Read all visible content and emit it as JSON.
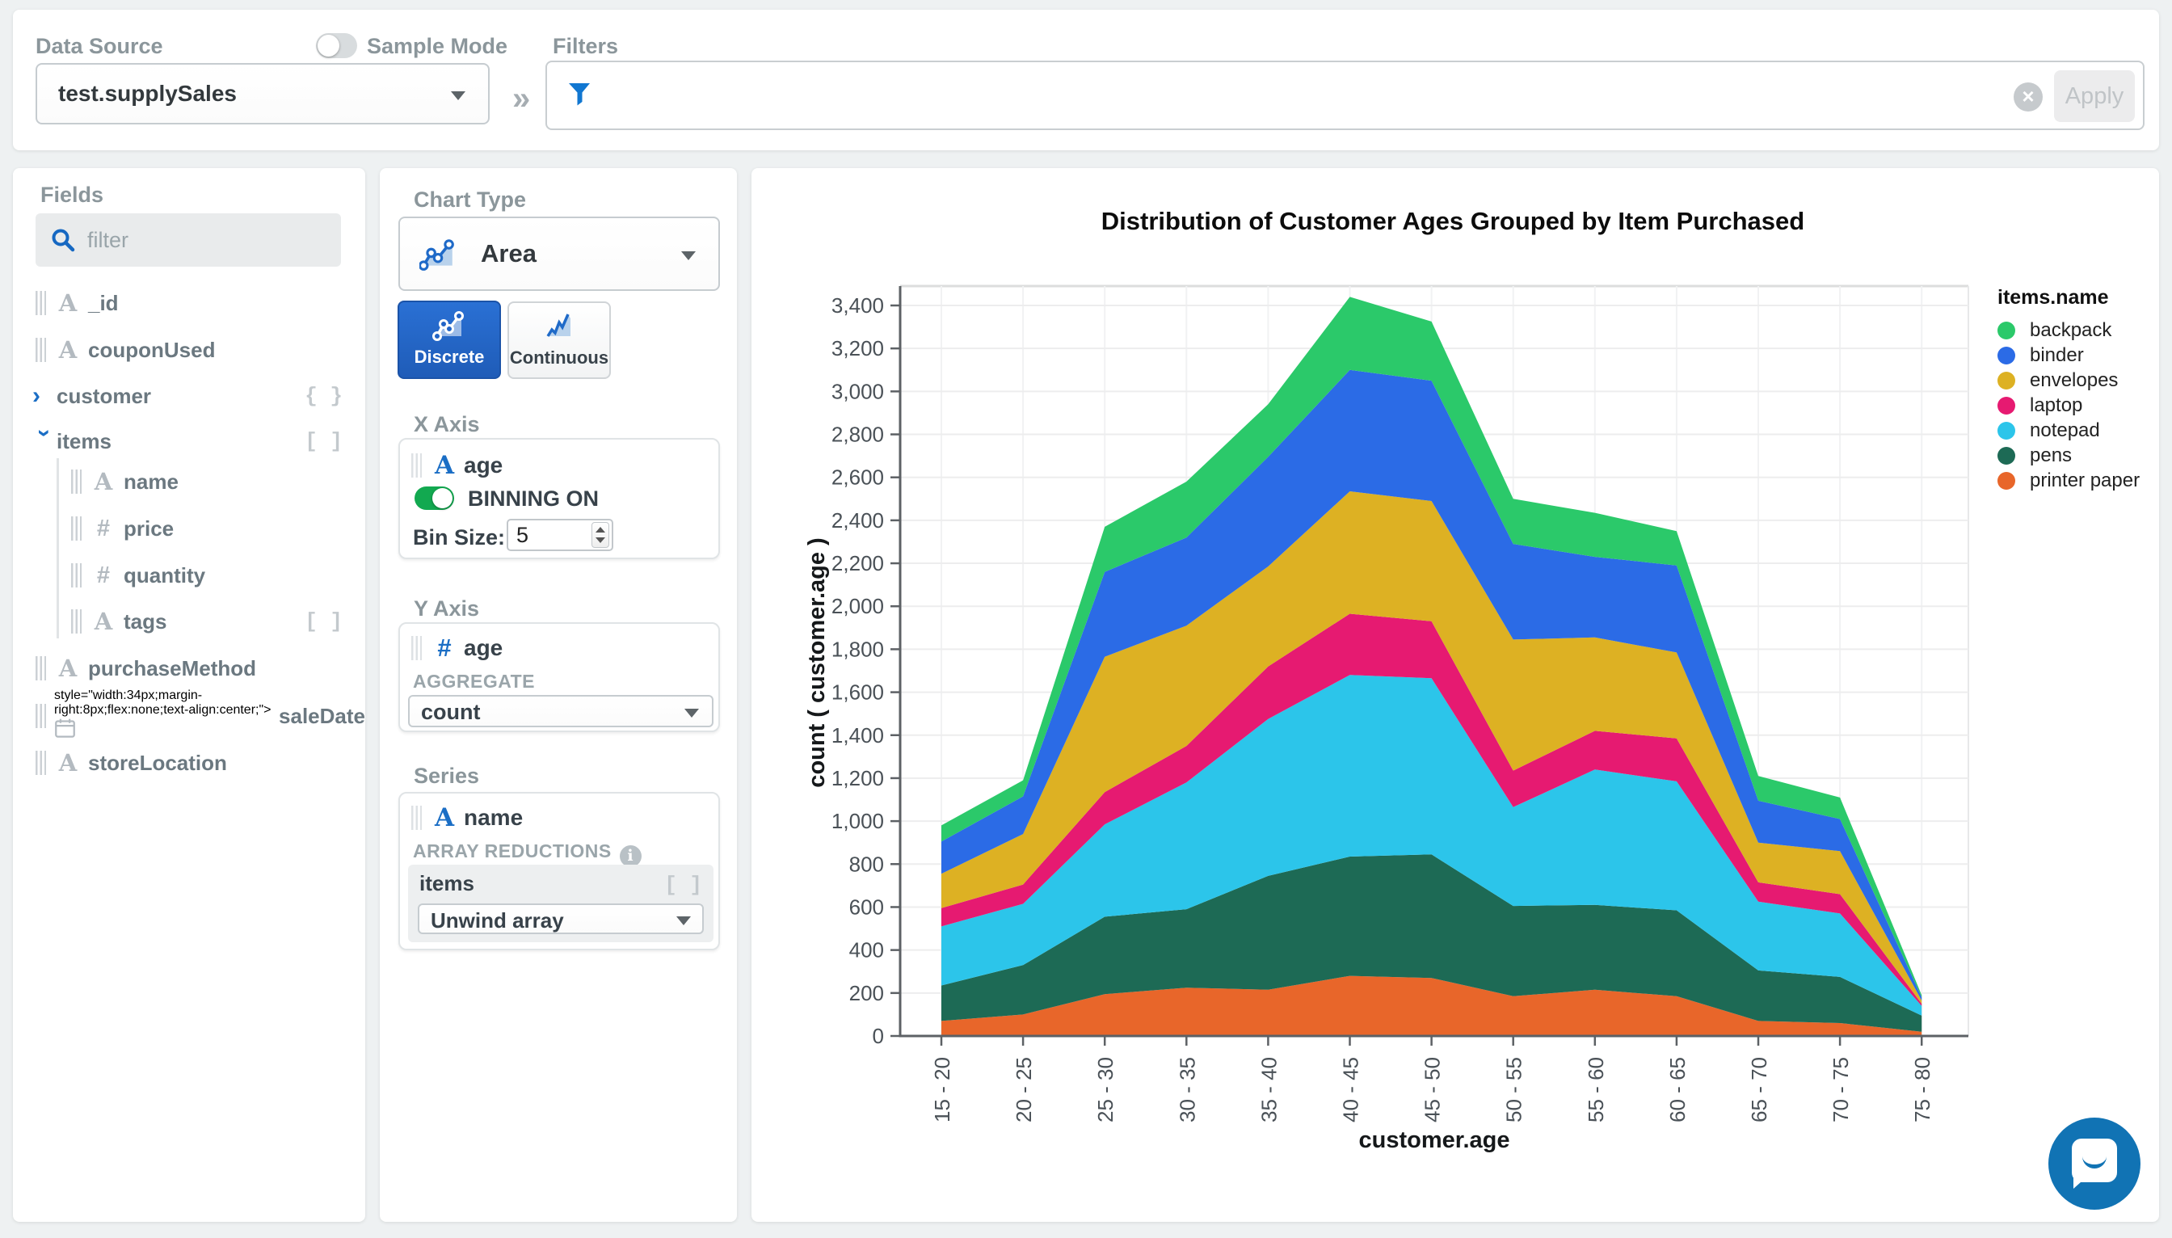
{
  "top_bar": {
    "data_source_label": "Data Source",
    "data_source_value": "test.supplySales",
    "sample_mode_label": "Sample Mode",
    "filters_label": "Filters",
    "chevron": "»",
    "clear_icon": "×",
    "apply_label": "Apply",
    "filter_value": ""
  },
  "fields_panel": {
    "title": "Fields",
    "filter_placeholder": "filter",
    "fields": [
      {
        "name": "_id",
        "type": "string"
      },
      {
        "name": "couponUsed",
        "type": "string"
      },
      {
        "name": "customer",
        "type": "object",
        "marker": "{ }",
        "expanded": false
      },
      {
        "name": "items",
        "type": "array",
        "marker": "[ ]",
        "expanded": true
      },
      {
        "name": "name",
        "type": "string",
        "nested": true
      },
      {
        "name": "price",
        "type": "number",
        "nested": true
      },
      {
        "name": "quantity",
        "type": "number",
        "nested": true
      },
      {
        "name": "tags",
        "type": "string",
        "nested": true,
        "marker": "[ ]"
      },
      {
        "name": "purchaseMethod",
        "type": "string"
      },
      {
        "name": "saleDate",
        "type": "date"
      },
      {
        "name": "storeLocation",
        "type": "string"
      }
    ]
  },
  "config_panel": {
    "chart_type_label": "Chart Type",
    "chart_type_value": "Area",
    "discrete_label": "Discrete",
    "continuous_label": "Continuous",
    "x_axis": {
      "label": "X Axis",
      "field": "age",
      "binning_label": "BINNING ON",
      "bin_size_label": "Bin Size:",
      "bin_size_value": "5"
    },
    "y_axis": {
      "label": "Y Axis",
      "field": "age",
      "aggregate_label": "AGGREGATE",
      "aggregate_value": "count"
    },
    "series": {
      "label": "Series",
      "field": "name",
      "array_reductions_label": "ARRAY REDUCTIONS",
      "reduction_field": "items",
      "reduction_marker": "[ ]",
      "reduction_value": "Unwind array"
    }
  },
  "chart_data": {
    "type": "area",
    "stacked": true,
    "stack_order": "reversed (printer paper at bottom, backpack on top)",
    "title": "Distribution of Customer Ages Grouped by Item Purchased",
    "xlabel": "customer.age",
    "ylabel": "count ( customer.age )",
    "legend_title": "items.name",
    "legend_position": "right",
    "grid": true,
    "ylim": [
      0,
      3400
    ],
    "ytick_step": 200,
    "categories": [
      "15 - 20",
      "20 - 25",
      "25 - 30",
      "30 - 35",
      "35 - 40",
      "40 - 45",
      "45 - 50",
      "50 - 55",
      "55 - 60",
      "60 - 65",
      "65 - 70",
      "70 - 75",
      "75 - 80"
    ],
    "series": [
      {
        "name": "backpack",
        "color": "#2bc96a",
        "values": [
          75,
          75,
          210,
          260,
          245,
          340,
          275,
          210,
          205,
          160,
          115,
          100,
          10
        ]
      },
      {
        "name": "binder",
        "color": "#2b6be6",
        "values": [
          150,
          175,
          395,
          410,
          510,
          565,
          560,
          445,
          375,
          405,
          195,
          150,
          15
        ]
      },
      {
        "name": "envelopes",
        "color": "#ddb123",
        "values": [
          160,
          235,
          630,
          560,
          465,
          570,
          560,
          610,
          435,
          400,
          185,
          200,
          15
        ]
      },
      {
        "name": "laptop",
        "color": "#e61a71",
        "values": [
          85,
          90,
          150,
          170,
          245,
          285,
          265,
          170,
          180,
          200,
          90,
          90,
          10
        ]
      },
      {
        "name": "notepad",
        "color": "#2cc5ea",
        "values": [
          275,
          285,
          430,
          590,
          730,
          845,
          820,
          460,
          630,
          600,
          320,
          295,
          45
        ]
      },
      {
        "name": "pens",
        "color": "#1d6a55",
        "values": [
          165,
          230,
          360,
          365,
          530,
          555,
          575,
          420,
          395,
          400,
          235,
          215,
          75
        ]
      },
      {
        "name": "printer paper",
        "color": "#e8662a",
        "values": [
          70,
          100,
          195,
          225,
          215,
          280,
          270,
          185,
          215,
          185,
          70,
          60,
          20
        ]
      }
    ]
  }
}
